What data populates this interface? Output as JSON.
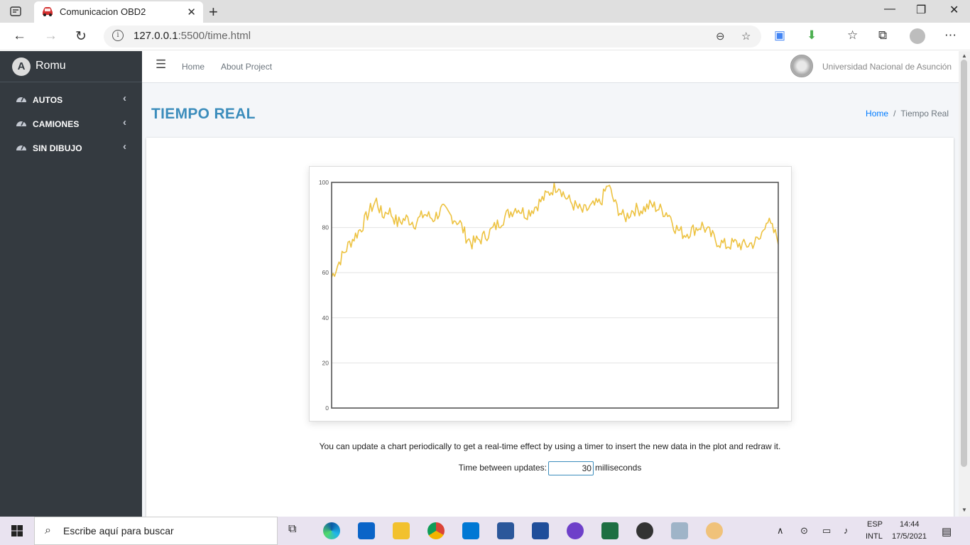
{
  "browser": {
    "tab_title": "Comunicacion OBD2",
    "url_host": "127.0.0.1",
    "url_rest": ":5500/time.html"
  },
  "sidebar": {
    "brand": "Romu",
    "items": [
      {
        "label": "AUTOS"
      },
      {
        "label": "CAMIONES"
      },
      {
        "label": "SIN DIBUJO"
      }
    ]
  },
  "navbar": {
    "links": [
      "Home",
      "About Project"
    ],
    "university": "Universidad Nacional de Asunción"
  },
  "page": {
    "title": "TIEMPO REAL",
    "breadcrumb": {
      "home": "Home",
      "current": "Tiempo Real"
    },
    "description": "You can update a chart periodically to get a real-time effect by using a timer to insert the new data in the plot and redraw it.",
    "update_label": "Time between updates:",
    "update_value": "30",
    "update_unit": "milliseconds"
  },
  "chart_data": {
    "type": "line",
    "ylim": [
      0,
      100
    ],
    "yticks": [
      "0",
      "20",
      "40",
      "60",
      "80",
      "100"
    ],
    "grid": true,
    "color": "#edc240",
    "n_points": 300,
    "anchors": [
      [
        0,
        58
      ],
      [
        6,
        66
      ],
      [
        12,
        73
      ],
      [
        20,
        80
      ],
      [
        25,
        87
      ],
      [
        30,
        92
      ],
      [
        34,
        85
      ],
      [
        38,
        88
      ],
      [
        44,
        82
      ],
      [
        50,
        84
      ],
      [
        56,
        82
      ],
      [
        62,
        86
      ],
      [
        68,
        84
      ],
      [
        74,
        88
      ],
      [
        80,
        85
      ],
      [
        86,
        82
      ],
      [
        90,
        76
      ],
      [
        94,
        73
      ],
      [
        100,
        75
      ],
      [
        106,
        78
      ],
      [
        112,
        82
      ],
      [
        118,
        86
      ],
      [
        124,
        89
      ],
      [
        130,
        86
      ],
      [
        136,
        89
      ],
      [
        142,
        93
      ],
      [
        148,
        97
      ],
      [
        152,
        99
      ],
      [
        156,
        94
      ],
      [
        162,
        90
      ],
      [
        168,
        87
      ],
      [
        174,
        89
      ],
      [
        180,
        91
      ],
      [
        185,
        99
      ],
      [
        190,
        90
      ],
      [
        196,
        84
      ],
      [
        202,
        88
      ],
      [
        208,
        88
      ],
      [
        214,
        90
      ],
      [
        220,
        88
      ],
      [
        226,
        86
      ],
      [
        230,
        80
      ],
      [
        236,
        77
      ],
      [
        242,
        79
      ],
      [
        248,
        81
      ],
      [
        252,
        78
      ],
      [
        258,
        74
      ],
      [
        264,
        72
      ],
      [
        270,
        73
      ],
      [
        276,
        72
      ],
      [
        282,
        73
      ],
      [
        287,
        75
      ],
      [
        291,
        84
      ],
      [
        296,
        78
      ],
      [
        299,
        75
      ]
    ]
  },
  "taskbar": {
    "search_placeholder": "Escribe aquí para buscar",
    "lang": "ESP",
    "layout": "INTL",
    "time": "14:44",
    "date": "17/5/2021"
  }
}
